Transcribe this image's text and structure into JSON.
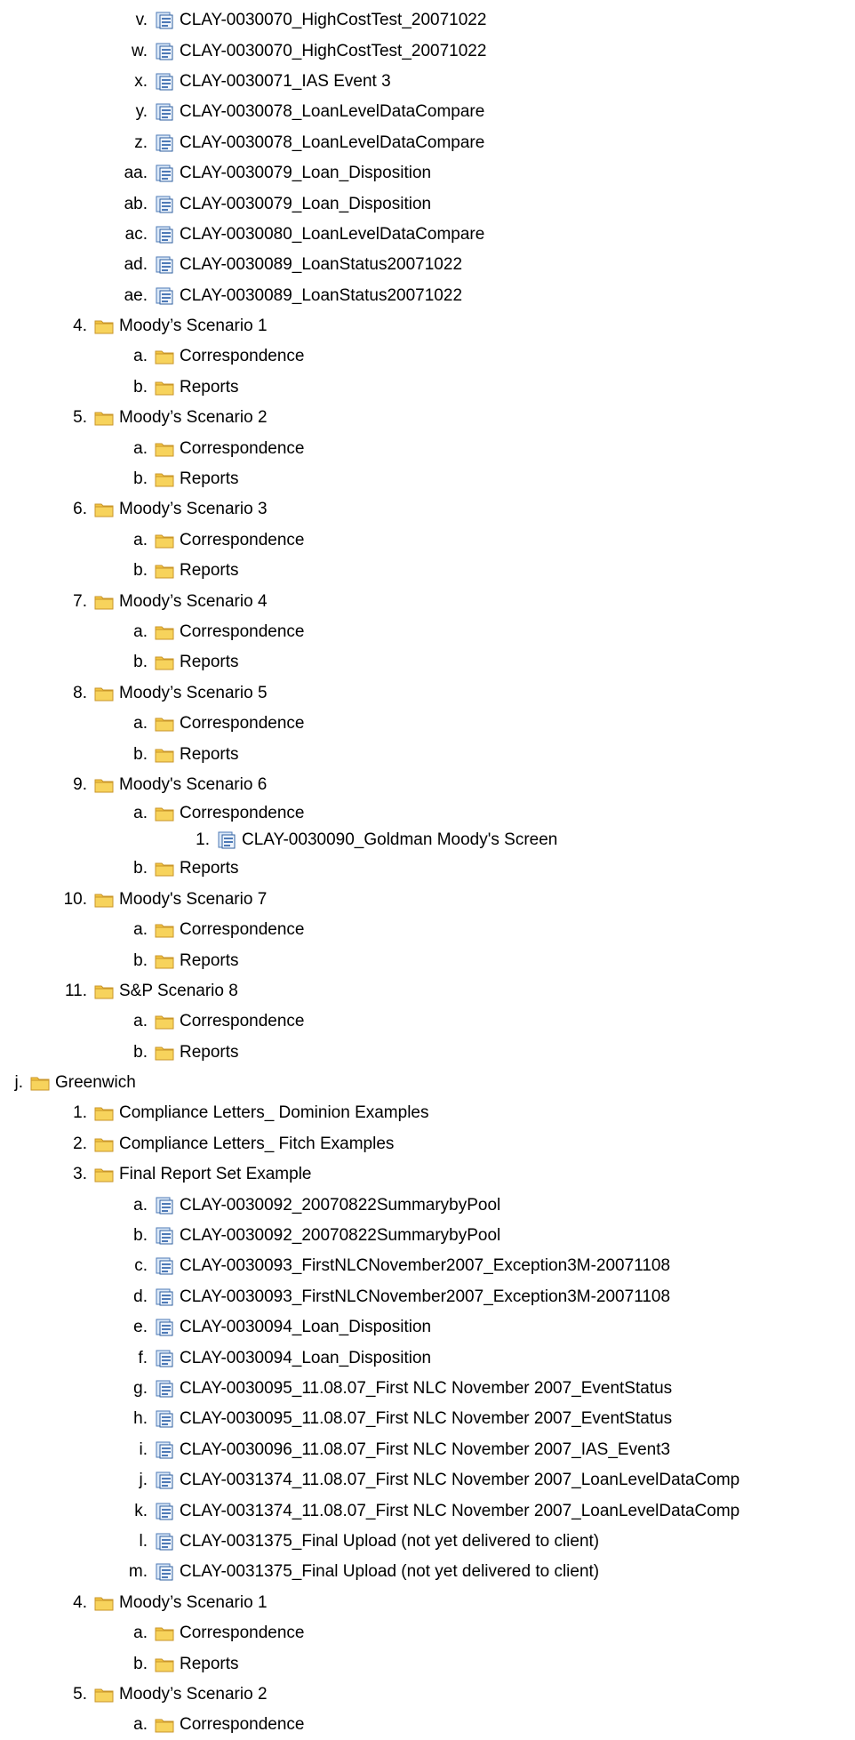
{
  "tree": [
    {
      "level": 3,
      "marker": "v.",
      "icon": "document-icon",
      "label": "CLAY-0030070_HighCostTest_20071022"
    },
    {
      "level": 3,
      "marker": "w.",
      "icon": "document-icon",
      "label": "CLAY-0030070_HighCostTest_20071022"
    },
    {
      "level": 3,
      "marker": "x.",
      "icon": "document-icon",
      "label": "CLAY-0030071_IAS Event 3"
    },
    {
      "level": 3,
      "marker": "y.",
      "icon": "document-icon",
      "label": "CLAY-0030078_LoanLevelDataCompare"
    },
    {
      "level": 3,
      "marker": "z.",
      "icon": "document-icon",
      "label": "CLAY-0030078_LoanLevelDataCompare"
    },
    {
      "level": 3,
      "marker": "aa.",
      "icon": "document-icon",
      "label": "CLAY-0030079_Loan_Disposition"
    },
    {
      "level": 3,
      "marker": "ab.",
      "icon": "document-icon",
      "label": "CLAY-0030079_Loan_Disposition"
    },
    {
      "level": 3,
      "marker": "ac.",
      "icon": "document-icon",
      "label": "CLAY-0030080_LoanLevelDataCompare"
    },
    {
      "level": 3,
      "marker": "ad.",
      "icon": "document-icon",
      "label": "CLAY-0030089_LoanStatus20071022"
    },
    {
      "level": 3,
      "marker": "ae.",
      "icon": "document-icon",
      "label": "CLAY-0030089_LoanStatus20071022"
    },
    {
      "level": 2,
      "marker": "4.",
      "icon": "folder-icon",
      "label": "Moody’s Scenario 1"
    },
    {
      "level": 3,
      "marker": "a.",
      "icon": "folder-icon",
      "label": "Correspondence"
    },
    {
      "level": 3,
      "marker": "b.",
      "icon": "folder-icon",
      "label": "Reports"
    },
    {
      "level": 2,
      "marker": "5.",
      "icon": "folder-icon",
      "label": "Moody’s Scenario 2"
    },
    {
      "level": 3,
      "marker": "a.",
      "icon": "folder-icon",
      "label": "Correspondence"
    },
    {
      "level": 3,
      "marker": "b.",
      "icon": "folder-icon",
      "label": "Reports"
    },
    {
      "level": 2,
      "marker": "6.",
      "icon": "folder-icon",
      "label": "Moody’s Scenario 3"
    },
    {
      "level": 3,
      "marker": "a.",
      "icon": "folder-icon",
      "label": "Correspondence"
    },
    {
      "level": 3,
      "marker": "b.",
      "icon": "folder-icon",
      "label": "Reports"
    },
    {
      "level": 2,
      "marker": "7.",
      "icon": "folder-icon",
      "label": "Moody’s Scenario 4"
    },
    {
      "level": 3,
      "marker": "a.",
      "icon": "folder-icon",
      "label": "Correspondence"
    },
    {
      "level": 3,
      "marker": "b.",
      "icon": "folder-icon",
      "label": "Reports"
    },
    {
      "level": 2,
      "marker": "8.",
      "icon": "folder-icon",
      "label": "Moody’s Scenario 5"
    },
    {
      "level": 3,
      "marker": "a.",
      "icon": "folder-icon",
      "label": "Correspondence"
    },
    {
      "level": 3,
      "marker": "b.",
      "icon": "folder-icon",
      "label": "Reports"
    },
    {
      "level": 2,
      "marker": "9.",
      "icon": "folder-icon",
      "label": "Moody's Scenario 6"
    },
    {
      "level": 3,
      "marker": "a.",
      "icon": "folder-icon",
      "label": "Correspondence",
      "tight": true
    },
    {
      "level": 4,
      "marker": "1.",
      "icon": "document-icon",
      "label": "CLAY-0030090_Goldman Moody's Screen",
      "tight": true
    },
    {
      "level": 3,
      "marker": "b.",
      "icon": "folder-icon",
      "label": "Reports"
    },
    {
      "level": 2,
      "marker": "10.",
      "icon": "folder-icon",
      "label": "Moody's Scenario 7"
    },
    {
      "level": 3,
      "marker": "a.",
      "icon": "folder-icon",
      "label": "Correspondence"
    },
    {
      "level": 3,
      "marker": "b.",
      "icon": "folder-icon",
      "label": "Reports"
    },
    {
      "level": 2,
      "marker": "11.",
      "icon": "folder-icon",
      "label": "S&P Scenario 8"
    },
    {
      "level": 3,
      "marker": "a.",
      "icon": "folder-icon",
      "label": "Correspondence"
    },
    {
      "level": 3,
      "marker": "b.",
      "icon": "folder-icon",
      "label": "Reports"
    },
    {
      "level": 1,
      "marker": "j.",
      "icon": "folder-icon",
      "label": "Greenwich"
    },
    {
      "level": 2,
      "marker": "1.",
      "icon": "folder-icon",
      "label": "Compliance Letters_ Dominion Examples"
    },
    {
      "level": 2,
      "marker": "2.",
      "icon": "folder-icon",
      "label": "Compliance Letters_ Fitch Examples"
    },
    {
      "level": 2,
      "marker": "3.",
      "icon": "folder-icon",
      "label": "Final Report Set Example"
    },
    {
      "level": 3,
      "marker": "a.",
      "icon": "document-icon",
      "label": "CLAY-0030092_20070822SummarybyPool"
    },
    {
      "level": 3,
      "marker": "b.",
      "icon": "document-icon",
      "label": "CLAY-0030092_20070822SummarybyPool"
    },
    {
      "level": 3,
      "marker": "c.",
      "icon": "document-icon",
      "label": "CLAY-0030093_FirstNLCNovember2007_Exception3M-20071108"
    },
    {
      "level": 3,
      "marker": "d.",
      "icon": "document-icon",
      "label": "CLAY-0030093_FirstNLCNovember2007_Exception3M-20071108"
    },
    {
      "level": 3,
      "marker": "e.",
      "icon": "document-icon",
      "label": "CLAY-0030094_Loan_Disposition"
    },
    {
      "level": 3,
      "marker": "f.",
      "icon": "document-icon",
      "label": "CLAY-0030094_Loan_Disposition"
    },
    {
      "level": 3,
      "marker": "g.",
      "icon": "document-icon",
      "label": "CLAY-0030095_11.08.07_First NLC November 2007_EventStatus"
    },
    {
      "level": 3,
      "marker": "h.",
      "icon": "document-icon",
      "label": "CLAY-0030095_11.08.07_First NLC November 2007_EventStatus"
    },
    {
      "level": 3,
      "marker": "i.",
      "icon": "document-icon",
      "label": "CLAY-0030096_11.08.07_First NLC November 2007_IAS_Event3"
    },
    {
      "level": 3,
      "marker": "j.",
      "icon": "document-icon",
      "label": "CLAY-0031374_11.08.07_First NLC November 2007_LoanLevelDataComp"
    },
    {
      "level": 3,
      "marker": "k.",
      "icon": "document-icon",
      "label": "CLAY-0031374_11.08.07_First NLC November 2007_LoanLevelDataComp"
    },
    {
      "level": 3,
      "marker": "l.",
      "icon": "document-icon",
      "label": "CLAY-0031375_Final Upload (not yet delivered to client)"
    },
    {
      "level": 3,
      "marker": "m.",
      "icon": "document-icon",
      "label": "CLAY-0031375_Final Upload (not yet delivered to client)"
    },
    {
      "level": 2,
      "marker": "4.",
      "icon": "folder-icon",
      "label": "Moody’s Scenario 1"
    },
    {
      "level": 3,
      "marker": "a.",
      "icon": "folder-icon",
      "label": "Correspondence"
    },
    {
      "level": 3,
      "marker": "b.",
      "icon": "folder-icon",
      "label": "Reports"
    },
    {
      "level": 2,
      "marker": "5.",
      "icon": "folder-icon",
      "label": "Moody’s Scenario 2"
    },
    {
      "level": 3,
      "marker": "a.",
      "icon": "folder-icon",
      "label": "Correspondence"
    }
  ]
}
